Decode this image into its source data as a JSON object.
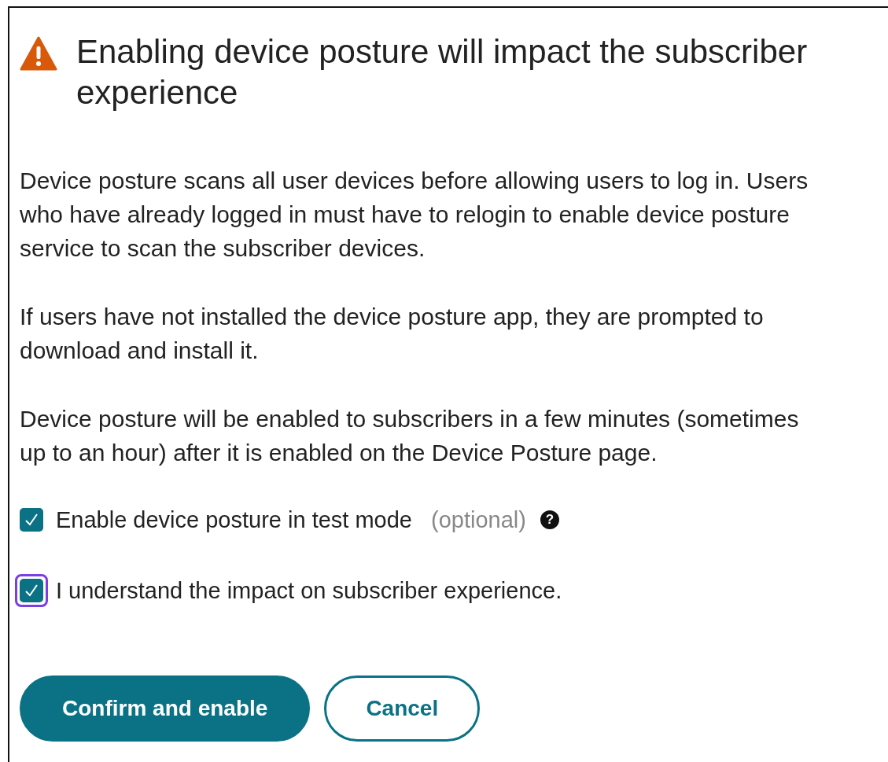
{
  "dialog": {
    "title": "Enabling device posture will impact the subscriber experience",
    "paragraphs": [
      "Device posture scans all user devices before allowing users to log in. Users\nwho have already logged in must have to relogin to enable device posture\nservice to scan the subscriber devices.",
      "If users have not installed the device posture app, they are prompted to\ndownload and install it.",
      "Device posture will be enabled to subscribers in a few minutes (sometimes\nup to an hour) after it is enabled on the Device Posture page."
    ],
    "checkboxes": [
      {
        "label": "Enable device posture in test mode",
        "note": "(optional)",
        "help": "?",
        "checked": true,
        "focused": false
      },
      {
        "label": "I understand the impact on subscriber experience.",
        "checked": true,
        "focused": true
      }
    ],
    "buttons": [
      {
        "label": "Confirm and enable",
        "kind": "primary"
      },
      {
        "label": "Cancel",
        "kind": "secondary"
      }
    ]
  }
}
